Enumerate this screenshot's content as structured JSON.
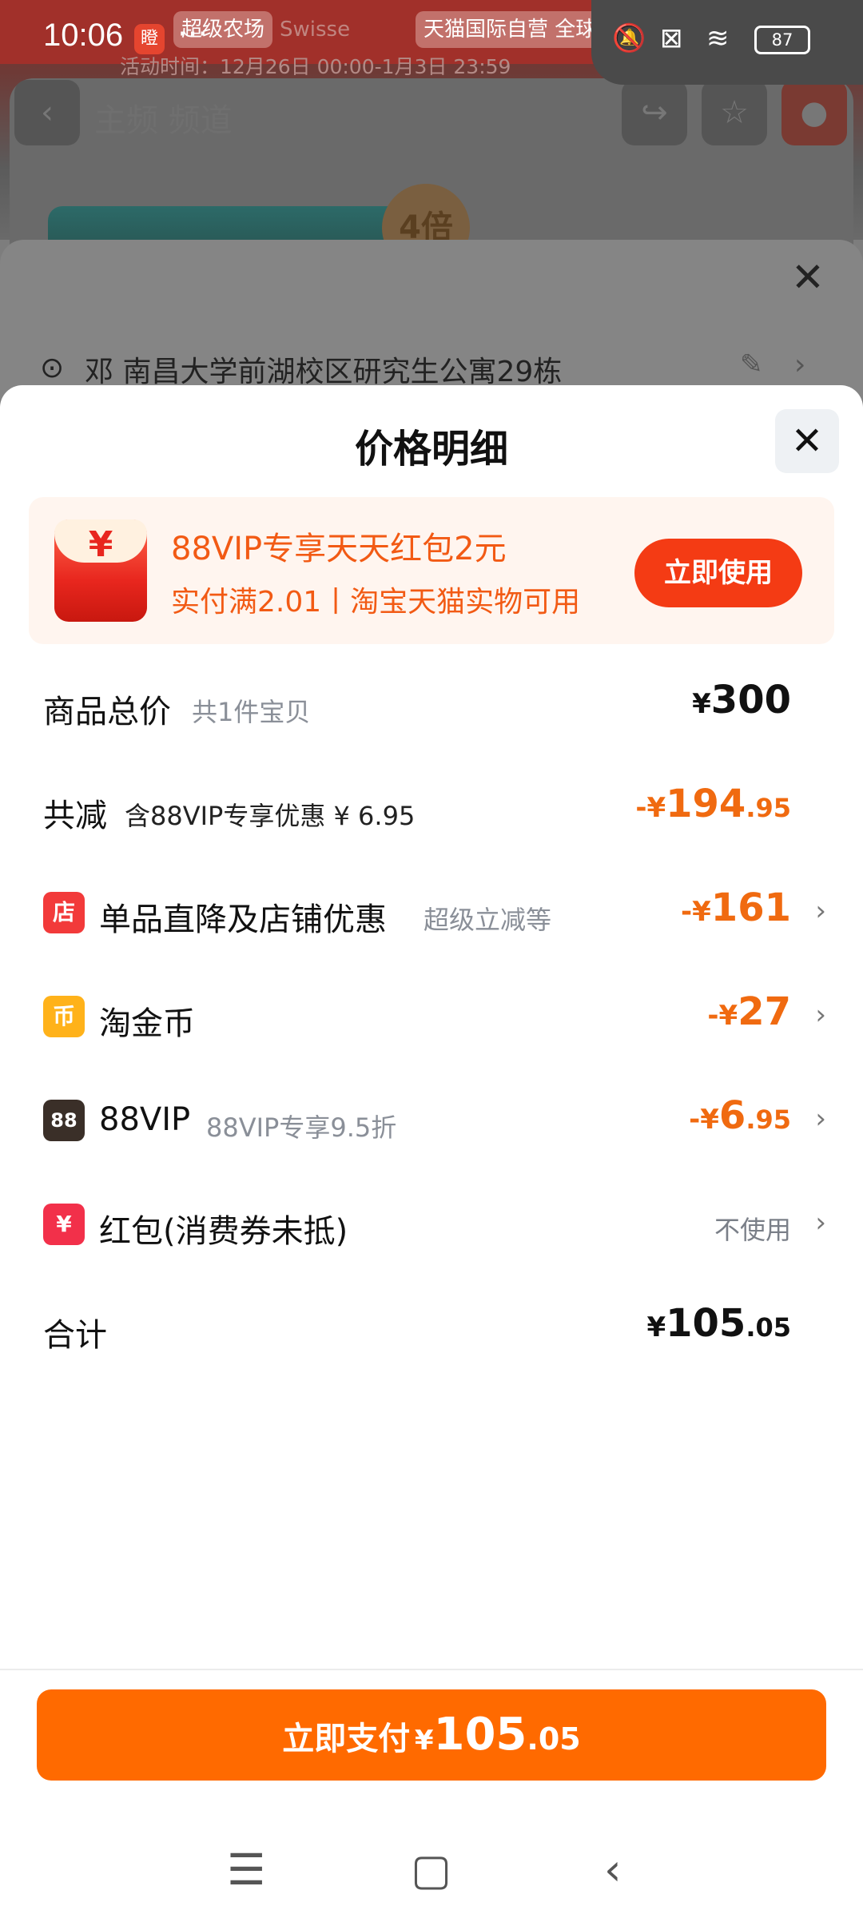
{
  "status_bar": {
    "time": "10:06",
    "app_badge": "瞪",
    "dots": "···",
    "battery": "87"
  },
  "background": {
    "campaign_tags": [
      "超级农场",
      "Swisse",
      "天猫国际自营 全球超级店"
    ],
    "subtitle": "活动时间：12月26日 00:00-1月3日 23:59",
    "badge": "4倍",
    "title": "主频 频道"
  },
  "address_sheet": {
    "close_glyph": "✕",
    "address": "邓  南昌大学前湖校区研究生公寓29栋"
  },
  "sheet": {
    "title": "价格明细",
    "close_glyph": "✕",
    "promo": {
      "line1": "88VIP专享天天红包2元",
      "line2": "实付满2.01丨淘宝天猫实物可用",
      "button": "立即使用"
    },
    "rows": {
      "total": {
        "label": "商品总价",
        "sub": "共1件宝贝",
        "currency": "¥",
        "amount": "300"
      },
      "discount": {
        "label": "共减",
        "sub": "含88VIP专享优惠 ¥ 6.95",
        "currency": "-¥",
        "amount": "194",
        "decimal": ".95"
      },
      "store": {
        "icon_glyph": "店",
        "label": "单品直降及店铺优惠",
        "sub": "超级立减等",
        "currency": "-¥",
        "amount": "161"
      },
      "coin": {
        "icon_glyph": "币",
        "label": "淘金币",
        "currency": "-¥",
        "amount": "27"
      },
      "vip": {
        "icon_glyph": "88",
        "label": "88VIP",
        "sub": "88VIP专享9.5折",
        "currency": "-¥",
        "amount": "6",
        "decimal": ".95"
      },
      "redpacket": {
        "icon_glyph": "¥",
        "label": "红包(消费券未抵)",
        "status": "不使用"
      },
      "sum": {
        "label": "合计",
        "currency": "¥",
        "amount": "105",
        "decimal": ".05"
      }
    },
    "pay_button": {
      "label": "立即支付",
      "currency": "¥",
      "amount": "105",
      "decimal": ".05"
    }
  },
  "nav": {
    "menu_glyph": "☰",
    "home_glyph": "▢",
    "back_glyph": "‹"
  },
  "colors": {
    "accent_orange": "#ff6a00",
    "discount_orange": "#f06a10",
    "use_button_red": "#f43b14"
  }
}
